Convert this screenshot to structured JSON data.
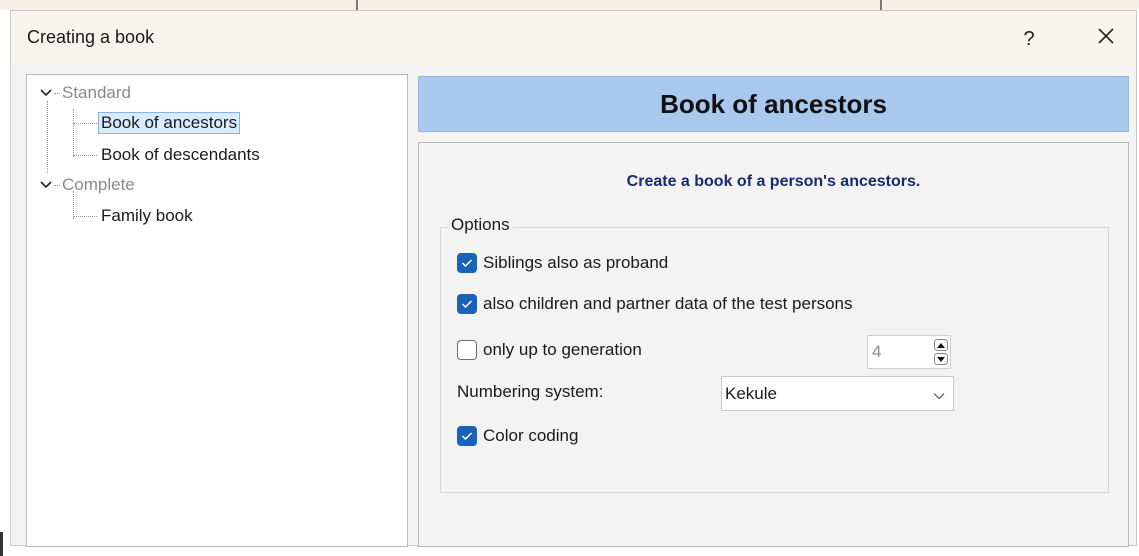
{
  "dialog": {
    "title": "Creating a book",
    "help_label": "?",
    "close_label": "✕"
  },
  "tree": {
    "groups": [
      {
        "label": "Standard",
        "expanded": true,
        "items": [
          "Book of ancestors",
          "Book of descendants"
        ]
      },
      {
        "label": "Complete",
        "expanded": true,
        "items": [
          "Family book"
        ]
      }
    ],
    "selected": "Book of ancestors"
  },
  "panel": {
    "header": "Book of ancestors",
    "description": "Create a book of a person's ancestors.",
    "options_title": "Options",
    "options": [
      {
        "label": "Siblings also as proband",
        "checked": true
      },
      {
        "label": "also children and partner data of the test persons",
        "checked": true
      },
      {
        "label": "only up to generation",
        "checked": false
      },
      {
        "label": "Color coding",
        "checked": true
      }
    ],
    "generation_value": "4",
    "numbering_label": "Numbering system:",
    "numbering_value": "Kekule"
  },
  "colors": {
    "header_bg": "#a8c8ee",
    "checkbox_on": "#1a62b8",
    "description_text": "#1b2a6e",
    "selection_bg": "#d9ecff"
  }
}
